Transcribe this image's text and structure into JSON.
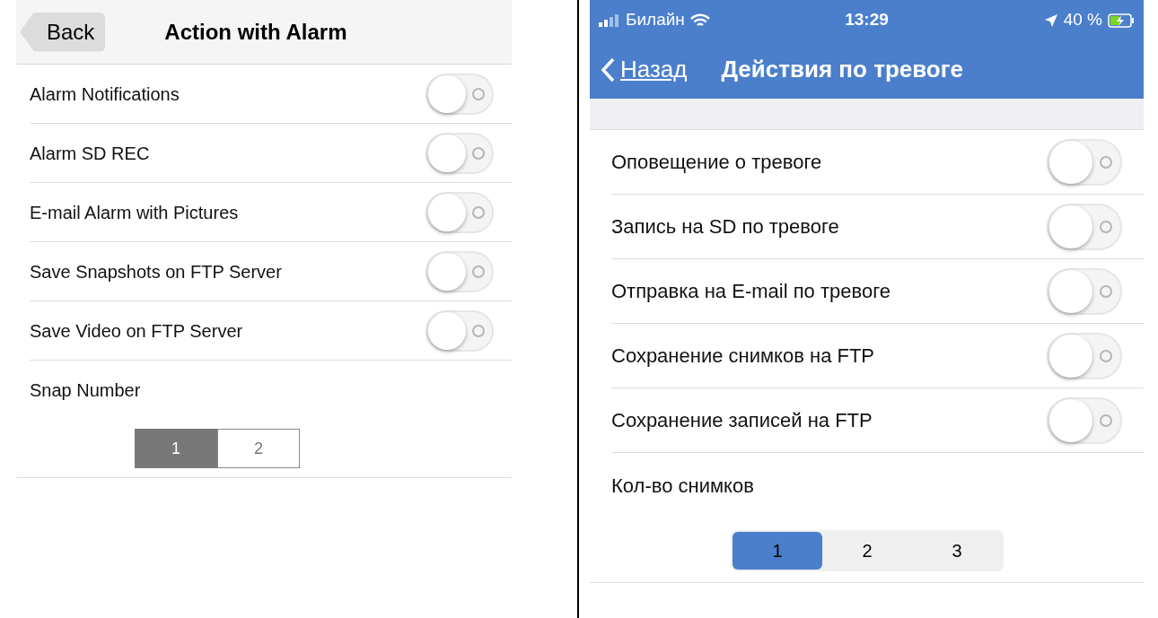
{
  "left": {
    "back": "Back",
    "title": "Action with Alarm",
    "rows": [
      {
        "label": "Alarm Notifications",
        "on": false
      },
      {
        "label": "Alarm SD REC",
        "on": false
      },
      {
        "label": "E-mail Alarm with Pictures",
        "on": false
      },
      {
        "label": "Save Snapshots on FTP Server",
        "on": false
      },
      {
        "label": "Save Video on FTP Server",
        "on": false
      }
    ],
    "snap_label": "Snap Number",
    "segments": [
      {
        "label": "1",
        "selected": true
      },
      {
        "label": "2",
        "selected": false
      }
    ]
  },
  "right": {
    "status": {
      "carrier": "Билайн",
      "time": "13:29",
      "battery": "40 %"
    },
    "back": "Назад",
    "title": "Действия по тревоге",
    "rows": [
      {
        "label": "Оповещение о тревоге",
        "on": false
      },
      {
        "label": "Запись на SD по тревоге",
        "on": false
      },
      {
        "label": "Отправка на E-mail по тревоге",
        "on": false
      },
      {
        "label": "Сохранение снимков на FTP",
        "on": false
      },
      {
        "label": "Сохранение записей на FTP",
        "on": false
      }
    ],
    "snap_label": "Кол-во снимков",
    "segments": [
      {
        "label": "1",
        "selected": true
      },
      {
        "label": "2",
        "selected": false
      },
      {
        "label": "3",
        "selected": false
      }
    ]
  }
}
